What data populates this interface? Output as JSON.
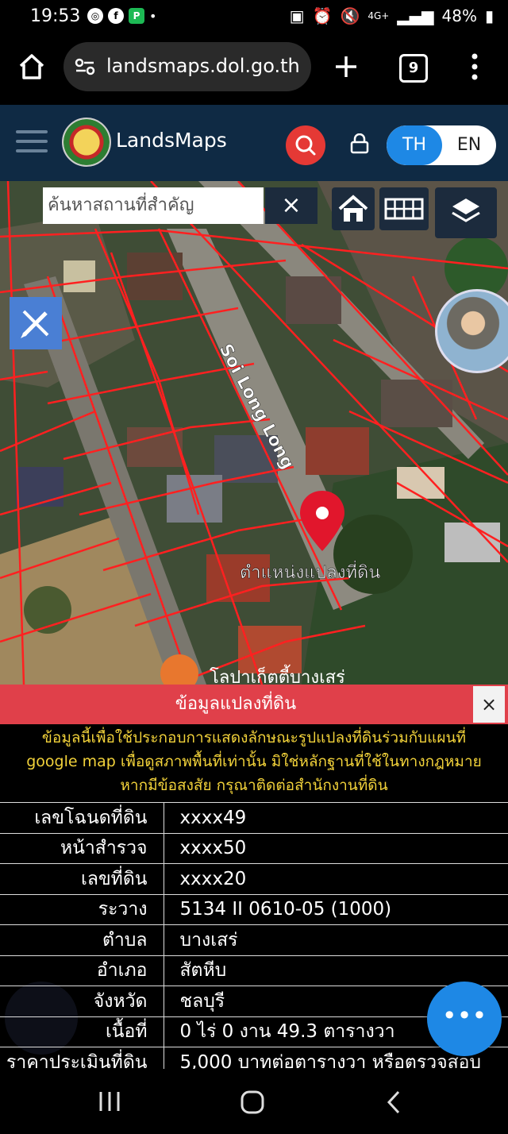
{
  "status_bar": {
    "time": "19:53",
    "battery": "48%",
    "network": "4G+"
  },
  "browser": {
    "url": "landsmaps.dol.go.th",
    "tab_count": "9"
  },
  "app": {
    "brand": "LandsMaps",
    "lang_th": "TH",
    "lang_en": "EN"
  },
  "map": {
    "search_placeholder": "ค้นหาสถานที่สำคัญ",
    "clear_label": "×",
    "street_label": "Soi Long Long",
    "marker_label": "ตำแหน่งแปลงที่ดิน",
    "poi_label": "โลปาเก็ตตี้บางเสร่"
  },
  "panel": {
    "title": "ข้อมูลแปลงที่ดิน",
    "close_label": "×",
    "disclaimer_line1": "ข้อมูลนี้เพื่อใช้ประกอบการแสดงลักษณะรูปแปลงที่ดินร่วมกับแผนที่",
    "disclaimer_line2": "google map เพื่อดูสภาพพื้นที่เท่านั้น มิใช่หลักฐานที่ใช้ในทางกฎหมาย",
    "disclaimer_line3": "หากมีข้อสงสัย กรุณาติดต่อสำนักงานที่ดิน",
    "rows": [
      {
        "label": "เลขโฉนดที่ดิน",
        "value": "xxxx49"
      },
      {
        "label": "หน้าสำรวจ",
        "value": "xxxx50"
      },
      {
        "label": "เลขที่ดิน",
        "value": "xxxx20"
      },
      {
        "label": "ระวาง",
        "value": "5134 II 0610-05 (1000)"
      },
      {
        "label": "ตำบล",
        "value": "บางเสร่"
      },
      {
        "label": "อำเภอ",
        "value": "สัตหีบ"
      },
      {
        "label": "จังหวัด",
        "value": "ชลบุรี"
      },
      {
        "label": "เนื้อที่",
        "value": "0 ไร่ 0 งาน 49.3 ตารางวา"
      },
      {
        "label": "ราคาประเมินที่ดิน",
        "value": "5,000 บาทต่อตารางวา หรือตรวจสอบ"
      }
    ]
  },
  "fab_label": "•••"
}
